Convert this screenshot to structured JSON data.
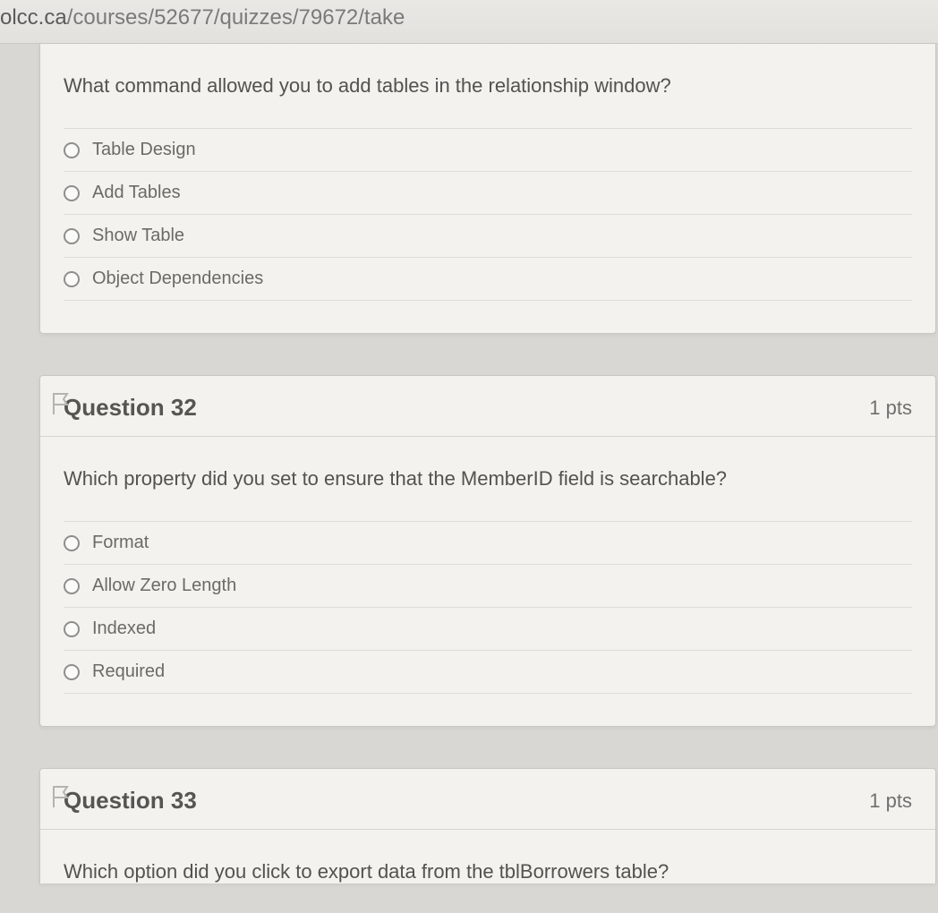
{
  "url": {
    "host": "olcc.ca",
    "path": "/courses/52677/quizzes/79672/take"
  },
  "questions": [
    {
      "title": "",
      "points": "",
      "text": "What command allowed you to add tables in the relationship window?",
      "options": [
        "Table Design",
        "Add Tables",
        "Show Table",
        "Object Dependencies"
      ]
    },
    {
      "title": "Question 32",
      "points": "1 pts",
      "text": "Which property did you set to ensure that the MemberID field is searchable?",
      "options": [
        "Format",
        "Allow Zero Length",
        "Indexed",
        "Required"
      ]
    },
    {
      "title": "Question 33",
      "points": "1 pts",
      "text": "Which option did you click to export data from the tblBorrowers table?",
      "options": []
    }
  ]
}
